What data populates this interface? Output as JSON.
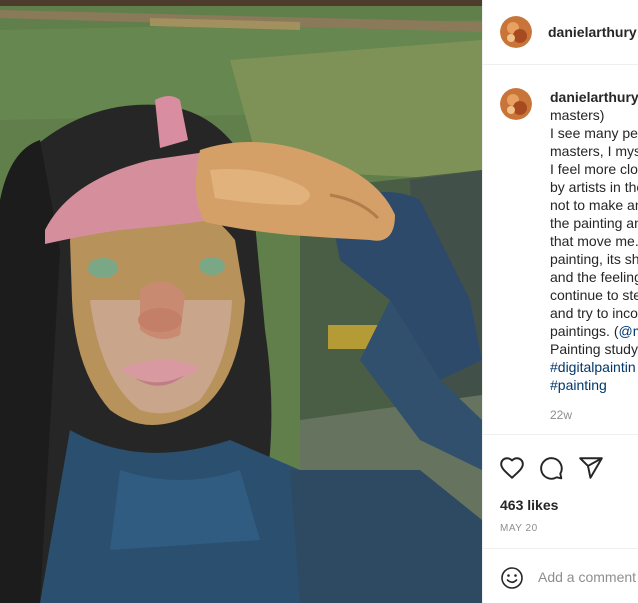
{
  "post": {
    "username": "danielarthury",
    "image": {
      "subject": "digital painting of a woman shading her eyes"
    },
    "caption": {
      "author": "danielarthury",
      "lines": [
        "masters)",
        "I see many peo",
        "masters, I myse",
        "I feel more clos",
        "by artists in the",
        "not to make an",
        "the painting an",
        "that move me.",
        "painting, its sh",
        "and the feeling",
        "continue to ste",
        "and try to inco",
        "paintings. (",
        "Painting study)",
        "#digitalpaintin",
        "#painting"
      ],
      "mention_fragment": "@m"
    },
    "age": "22w",
    "likes": "463 likes",
    "date": "MAY 20",
    "comment_placeholder": "Add a comment"
  },
  "icons": {
    "like": "heart-icon",
    "comment": "comment-icon",
    "share": "paper-plane-icon",
    "emoji": "emoji-smile-icon"
  },
  "colors": {
    "hashtag": "#00376b",
    "muted": "#8e8e8e",
    "text": "#262626",
    "divider": "#efefef"
  }
}
